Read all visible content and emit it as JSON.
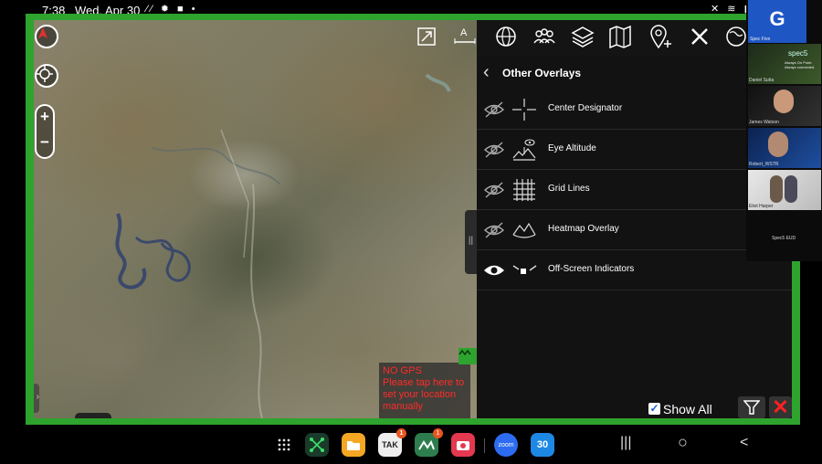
{
  "status_bar": {
    "time": "7:38",
    "date": "Wed, Apr 30",
    "left_icons": [
      "notification-icon",
      "gear-icon",
      "video-icon",
      "dot-icon"
    ],
    "right_icons": [
      "mute-icon",
      "wifi-icon",
      "battery-icon"
    ]
  },
  "map": {
    "no_gps_text": "NO GPS\nPlease tap here to set your location manually",
    "controls": [
      "north-compass-icon",
      "locate-icon",
      "zoom-in",
      "zoom-out"
    ],
    "zoom_in_label": "+",
    "zoom_out_label": "−"
  },
  "toolbar": {
    "icons": [
      "expand-icon",
      "altitude-scale-icon",
      "globe-icon",
      "team-icon",
      "layers-icon",
      "map-icon",
      "add-pin-icon",
      "tools-icon",
      "settings-globe-icon"
    ]
  },
  "panel": {
    "title": "Other Overlays",
    "items": [
      {
        "label": "Center Designator",
        "visible": false,
        "icon": "crosshair-icon"
      },
      {
        "label": "Eye Altitude",
        "visible": false,
        "icon": "eye-altitude-icon"
      },
      {
        "label": "Grid Lines",
        "visible": false,
        "icon": "grid-icon"
      },
      {
        "label": "Heatmap Overlay",
        "visible": false,
        "icon": "heatmap-icon"
      },
      {
        "label": "Off-Screen Indicators",
        "visible": true,
        "icon": "offscreen-indicator-icon"
      }
    ],
    "show_all_label": "Show All",
    "show_all_checked": true
  },
  "video_call": {
    "host_initial": "G",
    "host_label": "Spec Five",
    "participants": [
      {
        "name": "Daniel Sutta"
      },
      {
        "name": "James Watson"
      },
      {
        "name": "Robert_WSTR"
      },
      {
        "name": "Eliot Harper"
      }
    ],
    "footer_label": "Spec5 EUD",
    "spec5_logo_text": "spec5",
    "spec5_tagline": "Always On Point. Always connected."
  },
  "taskbar": {
    "apps": [
      {
        "name": "app-drawer",
        "label": ""
      },
      {
        "name": "spec5-app",
        "label": "",
        "badge": ""
      },
      {
        "name": "files-app",
        "label": "",
        "badge": ""
      },
      {
        "name": "tak-app",
        "label": "TAK",
        "badge": "1"
      },
      {
        "name": "atak-app",
        "label": "",
        "badge": "1"
      },
      {
        "name": "camera-app",
        "label": "",
        "badge": ""
      },
      {
        "name": "zoom-app",
        "label": "zoom",
        "badge": ""
      },
      {
        "name": "calendar-app",
        "label": "30",
        "badge": ""
      }
    ],
    "nav_recents": "|||",
    "nav_home": "○",
    "nav_back": "<"
  },
  "colors": {
    "frame_green": "#2ea32e",
    "panel_bg": "#121212",
    "no_gps_red": "#ff2b2b",
    "zoom_tile_blue": "#1e56c4"
  }
}
